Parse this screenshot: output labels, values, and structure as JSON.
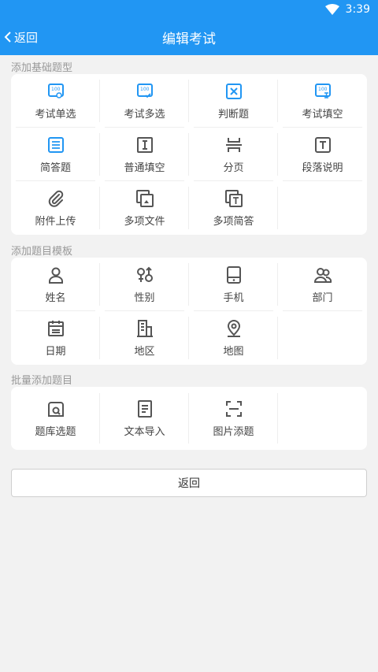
{
  "status": {
    "time": "3:39"
  },
  "appbar": {
    "back_label": "返回",
    "title": "编辑考试"
  },
  "sections": {
    "basic": {
      "label": "添加基础题型",
      "items": [
        "考试单选",
        "考试多选",
        "判断题",
        "考试填空",
        "简答题",
        "普通填空",
        "分页",
        "段落说明",
        "附件上传",
        "多项文件",
        "多项简答"
      ]
    },
    "template": {
      "label": "添加题目模板",
      "items": [
        "姓名",
        "性别",
        "手机",
        "部门",
        "日期",
        "地区",
        "地图"
      ]
    },
    "batch": {
      "label": "批量添加题目",
      "items": [
        "题库选题",
        "文本导入",
        "图片添题"
      ]
    }
  },
  "footer": {
    "return_label": "返回"
  },
  "colors": {
    "primary": "#2196f3",
    "icon_gray": "#555555"
  }
}
